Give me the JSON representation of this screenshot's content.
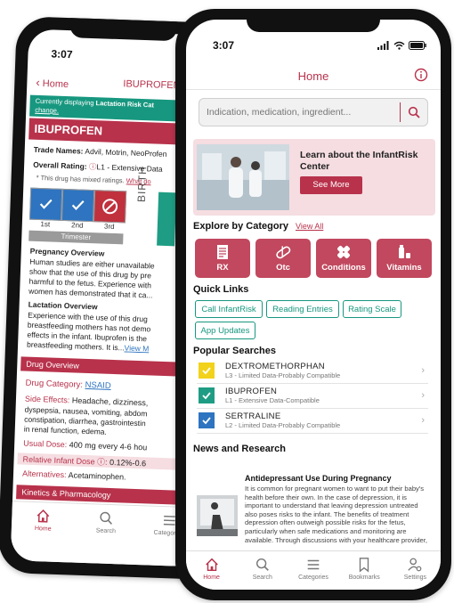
{
  "back_screen": {
    "status_time": "3:07",
    "nav": {
      "back_label": "Home",
      "title": "IBUPROFEN"
    },
    "banner": {
      "prefix": "Currently displaying ",
      "bold": "Lactation Risk Cat",
      "link": "change."
    },
    "drug_name": "IBUPROFEN",
    "trade_names_label": "Trade Names:",
    "trade_names_value": "Advil, Motrin, NeoProfen",
    "overall_rating_label": "Overall Rating:",
    "overall_rating_value": "L1 - Extensive Data",
    "mixed_note": "* This drug has mixed ratings.",
    "mixed_link": "What do",
    "trimesters": [
      {
        "label": "1st",
        "color": "#2e74c0"
      },
      {
        "label": "2nd",
        "color": "#2e74c0"
      },
      {
        "label": "3rd",
        "color": "#c0303d"
      }
    ],
    "trimester_caption": "Trimester",
    "birth_label": "BIRTH",
    "pregnancy_overview_title": "Pregnancy Overview",
    "pregnancy_lines": [
      "Human studies are either unavailable",
      "show that the use of this drug by pre",
      "harmful to the fetus. Experience with",
      "women has demonstrated that it ca..."
    ],
    "lactation_overview_title": "Lactation Overview",
    "lactation_lines": [
      "Experience with the use of this drug",
      "breastfeeding mothers has not demo",
      "effects in the infant. Ibuprofen is the",
      "breastfeeding mothers. It is..."
    ],
    "lactation_view_more": "View M",
    "drug_overview_header": "Drug Overview",
    "drug_category_label": "Drug Category:",
    "drug_category_value": "NSAID",
    "side_effects_label": "Side Effects:",
    "side_effects_lines": [
      "Headache, dizziness,",
      "dyspepsia, nausea, vomiting, abdom",
      "constipation, diarrhea, gastrointestin",
      "in renal function, edema."
    ],
    "usual_dose_label": "Usual Dose:",
    "usual_dose_value": "400 mg every 4-6 hou",
    "rid_label": "Relative Infant Dose",
    "rid_value": "0.12%-0.6",
    "alternatives_label": "Alternatives:",
    "alternatives_value": "Acetaminophen.",
    "kinetics_header": "Kinetics & Pharmacology",
    "tabs": [
      "Home",
      "Search",
      "Categories"
    ]
  },
  "front_screen": {
    "status_time": "3:07",
    "header_title": "Home",
    "search_placeholder": "Indication, medication, ingredient...",
    "promo": {
      "title": "Learn about the InfantRisk Center",
      "button": "See More"
    },
    "explore_title": "Explore by Category",
    "explore_view_all": "View All",
    "categories": [
      {
        "label": "RX",
        "icon": "document-icon"
      },
      {
        "label": "Otc",
        "icon": "pill-icon"
      },
      {
        "label": "Conditions",
        "icon": "bandage-icon"
      },
      {
        "label": "Vitamins",
        "icon": "bottle-icon"
      }
    ],
    "quick_links_title": "Quick Links",
    "quick_links": [
      "Call InfantRisk",
      "Reading Entries",
      "Rating Scale",
      "App Updates"
    ],
    "popular_title": "Popular Searches",
    "popular": [
      {
        "name": "DEXTROMETHORPHAN",
        "sub": "L3 - Limited Data-Probably Compatible",
        "color": "#f2d21b"
      },
      {
        "name": "IBUPROFEN",
        "sub": "L1 - Extensive Data-Compatible",
        "color": "#1f9d84"
      },
      {
        "name": "SERTRALINE",
        "sub": "L2 - Limited Data-Probably Compatible",
        "color": "#2e74c0"
      }
    ],
    "news_title": "News and Research",
    "news_item_title": "Antidepressant Use During Pregnancy",
    "news_item_body": "It is common for pregnant women to want to put their baby's health before their own. In the case of depression, it is important to understand that leaving depression untreated also poses risks to the infant. The benefits of treatment depression often outweigh possible risks for the fetus, particularly when safe medications and monitoring are available. Through discussions with your healthcare provider,",
    "tabs": [
      "Home",
      "Search",
      "Categories",
      "Bookmarks",
      "Settings"
    ],
    "accent_color": "#b8324b",
    "teal_color": "#17977f"
  }
}
